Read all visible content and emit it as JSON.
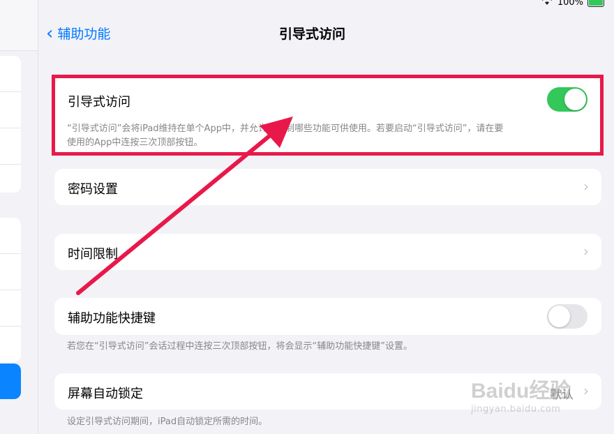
{
  "status": {
    "battery": "100%"
  },
  "nav": {
    "back_label": "辅助功能",
    "title": "引导式访问"
  },
  "guided_access": {
    "label": "引导式访问",
    "enabled": true,
    "description_line1": "“引导式访问”会将iPad维持在单个App中，并允许您控制哪些功能可供使用。若要启动“引导式访问”，请在要",
    "description_line2": "使用的App中连按三次顶部按钮。"
  },
  "passcode": {
    "label": "密码设置"
  },
  "time_limits": {
    "label": "时间限制"
  },
  "accessibility_shortcut": {
    "label": "辅助功能快捷键",
    "enabled": false,
    "description": "若您在“引导式访问”会话过程中连按三次顶部按钮，将会显示“辅助功能快捷键”设置。"
  },
  "auto_lock": {
    "label": "屏幕自动锁定",
    "value": "默认",
    "description": "设定引导式访问期间，iPad自动锁定所需的时间。"
  },
  "watermark": {
    "logo": "Baidu经验",
    "site": "jingyan.baidu.com"
  },
  "colors": {
    "accent": "#007aff",
    "toggle_on": "#34c759",
    "annotation": "#e8194a"
  }
}
